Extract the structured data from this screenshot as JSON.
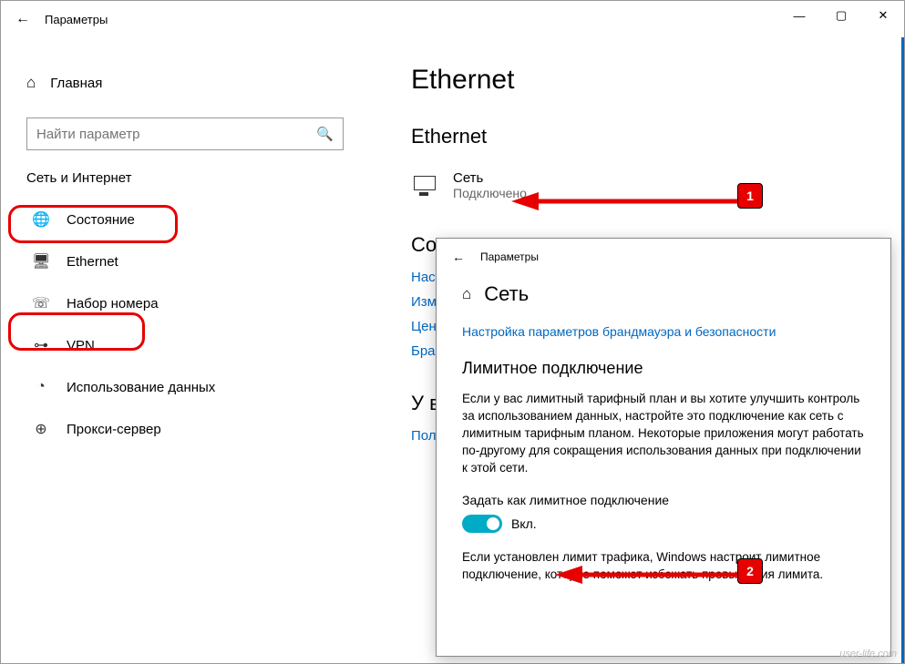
{
  "titlebar": {
    "title": "Параметры"
  },
  "sidebar": {
    "home": "Главная",
    "search_placeholder": "Найти параметр",
    "section": "Сеть и Интернет",
    "items": [
      {
        "label": "Состояние"
      },
      {
        "label": "Ethernet"
      },
      {
        "label": "Набор номера"
      },
      {
        "label": "VPN"
      },
      {
        "label": "Использование данных"
      },
      {
        "label": "Прокси-сервер"
      }
    ]
  },
  "content": {
    "heading": "Ethernet",
    "subheading": "Ethernet",
    "network": {
      "name": "Сеть",
      "status": "Подключено"
    },
    "section_related_prefix": "Со",
    "links": [
      "Наст",
      "Изме",
      "Цент",
      "Бран"
    ],
    "section_help_prefix": "У ва",
    "help_link": "Полу"
  },
  "overlay": {
    "titlebar": "Параметры",
    "page_title": "Сеть",
    "firewall_link": "Настройка параметров брандмауэра и безопасности",
    "metered_heading": "Лимитное подключение",
    "metered_desc": "Если у вас лимитный тарифный план и вы хотите улучшить контроль за использованием данных, настройте это подключение как сеть с лимитным тарифным планом. Некоторые приложения могут работать по-другому для сокращения использования данных при подключении к этой сети.",
    "toggle_label": "Задать как лимитное подключение",
    "toggle_state": "Вкл.",
    "note": "Если установлен лимит трафика, Windows настроит лимитное подключение, которое поможет избежать превышения лимита."
  },
  "callouts": {
    "c1": "1",
    "c2": "2"
  },
  "watermark": "user-life.com"
}
